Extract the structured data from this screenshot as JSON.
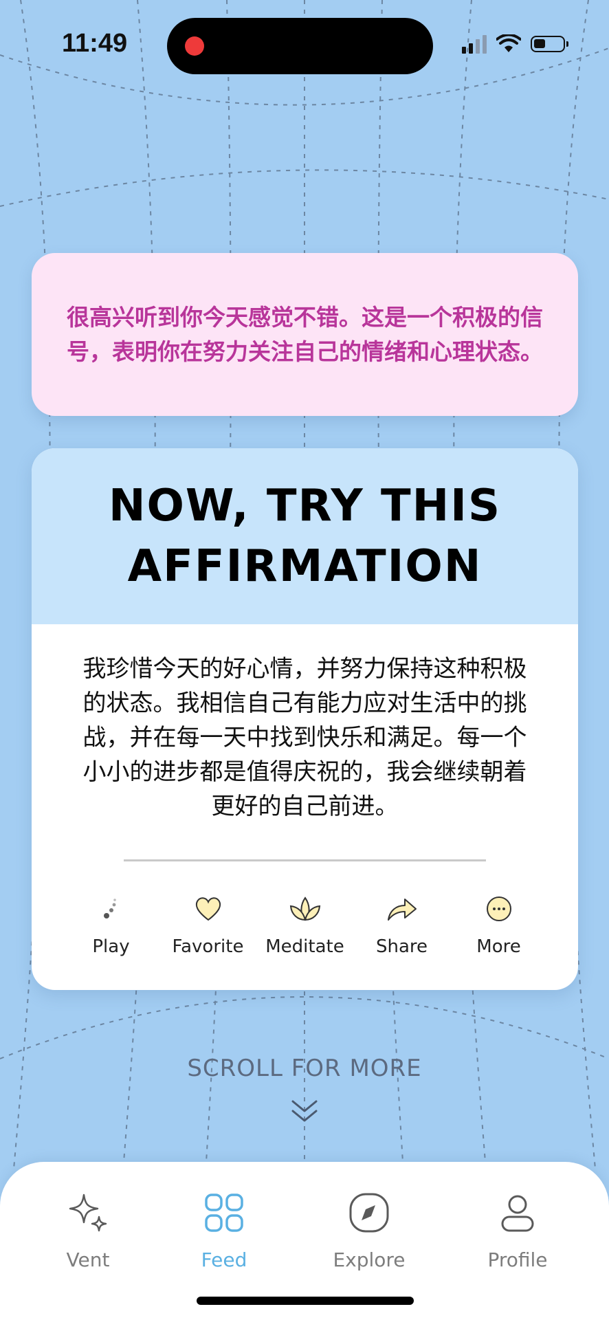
{
  "status_bar": {
    "time": "11:49"
  },
  "message": {
    "text": "很高兴听到你今天感觉不错。这是一个积极的信号，表明你在努力关注自己的情绪和心理状态。"
  },
  "affirmation": {
    "title": "NOW, TRY THIS AFFIRMATION",
    "body": "我珍惜今天的好心情，并努力保持这种积极的状态。我相信自己有能力应对生活中的挑战，并在每一天中找到快乐和满足。每一个小小的进步都是值得庆祝的，我会继续朝着更好的自己前进。",
    "actions": [
      {
        "label": "Play",
        "icon": "loading-dots-icon"
      },
      {
        "label": "Favorite",
        "icon": "heart-icon"
      },
      {
        "label": "Meditate",
        "icon": "lotus-icon"
      },
      {
        "label": "Share",
        "icon": "share-arrow-icon"
      },
      {
        "label": "More",
        "icon": "more-dots-icon"
      }
    ]
  },
  "scroll_hint": {
    "text": "SCROLL FOR MORE",
    "icon": "double-chevron-down-icon"
  },
  "tab_bar": {
    "tabs": [
      {
        "label": "Vent",
        "icon": "sparkle-icon",
        "active": false
      },
      {
        "label": "Feed",
        "icon": "grid-icon",
        "active": true
      },
      {
        "label": "Explore",
        "icon": "compass-icon",
        "active": false
      },
      {
        "label": "Profile",
        "icon": "person-icon",
        "active": false
      }
    ]
  },
  "colors": {
    "background": "#a3cdf2",
    "message_card": "#fde4f6",
    "message_text": "#b8359a",
    "affirmation_header": "#c7e4fb",
    "icon_fill": "#fdf0b8",
    "active_tab": "#5ab0e2"
  }
}
